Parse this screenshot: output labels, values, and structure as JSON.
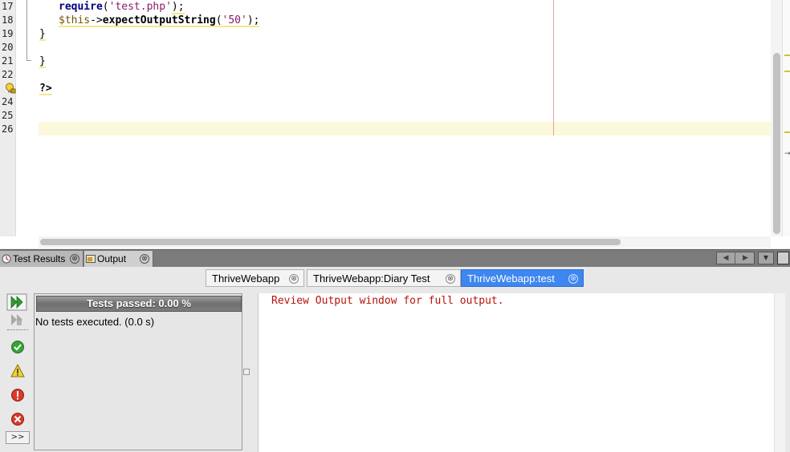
{
  "editor": {
    "line_numbers": [
      "17",
      "18",
      "19",
      "20",
      "21",
      "22",
      "",
      "24",
      "25",
      "26"
    ],
    "code": {
      "line17": {
        "fn": "require",
        "open": "(",
        "arg": "'test.php'",
        "close": ");"
      },
      "line18": {
        "var": "$this",
        "arrow": "->",
        "method": "expectOutputString",
        "open": "(",
        "arg": "'50'",
        "close": ");"
      },
      "line19": "}",
      "line21": "}",
      "line23": "?>"
    }
  },
  "window_tabs": {
    "test_results": "Test Results",
    "output": "Output",
    "close_glyph": "⊗"
  },
  "session_tabs": [
    {
      "label": "ThriveWebapp",
      "active": false
    },
    {
      "label": "ThriveWebapp:Diary Test",
      "active": false
    },
    {
      "label": "ThriveWebapp:test",
      "active": true
    }
  ],
  "results": {
    "progress_label": "Tests passed: 0.00 %",
    "progress_percent": 0,
    "status": "No tests executed. (0.0 s)",
    "more_label": ">>"
  },
  "output": {
    "message": "Review Output window for full output."
  },
  "icons": {
    "rerun": "rerun-icon",
    "rerun_failed": "rerun-failed-icon",
    "show_passed": "passed-check-icon",
    "show_warnings": "warning-icon",
    "show_failures": "failure-icon",
    "show_errors": "error-icon",
    "hint": "hint-bulb-icon"
  },
  "colors": {
    "active_tab": "#3e86f0",
    "output_text": "#b8120a",
    "current_line": "#fbf8dc"
  }
}
